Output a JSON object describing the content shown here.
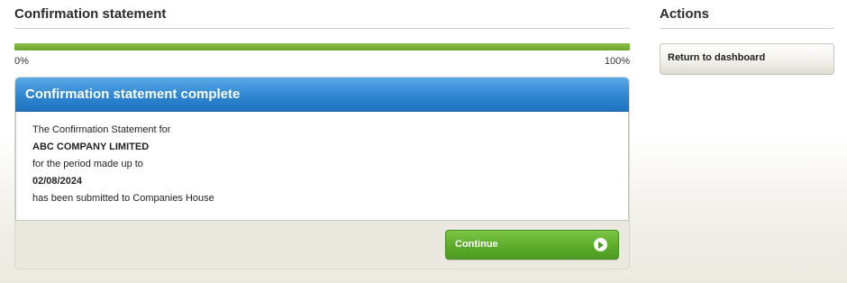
{
  "main": {
    "title": "Confirmation statement",
    "progress": {
      "percent": 100,
      "start_label": "0%",
      "end_label": "100%",
      "color": "#6ba32d"
    },
    "panel": {
      "header": "Confirmation statement complete",
      "header_color": "#2f86d1",
      "lines": [
        "The Confirmation Statement for",
        "ABC COMPANY LIMITED",
        "for the period made up to",
        "02/08/2024",
        "has been submitted to Companies House"
      ],
      "continue_label": "Continue",
      "continue_icon": "arrow-right-circle-icon"
    }
  },
  "side": {
    "title": "Actions",
    "return_label": "Return to dashboard"
  }
}
